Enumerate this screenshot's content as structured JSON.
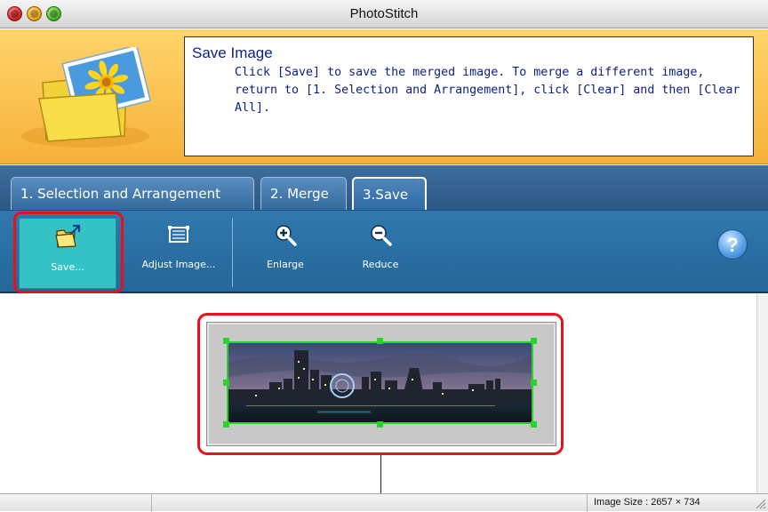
{
  "window": {
    "title": "PhotoStitch"
  },
  "header": {
    "heading": "Save Image",
    "description": "Click [Save] to save the merged image. To merge a different image, return to [1. Selection and Arrangement], click [Clear] and then [Clear All]."
  },
  "tabs": [
    {
      "label": "1. Selection and Arrangement",
      "active": false
    },
    {
      "label": "2. Merge",
      "active": false
    },
    {
      "label": "3.Save",
      "active": true
    }
  ],
  "toolbar": {
    "save_label": "Save...",
    "adjust_label": "Adjust Image...",
    "enlarge_label": "Enlarge",
    "reduce_label": "Reduce",
    "help_label": "?"
  },
  "status": {
    "image_size": "Image Size : 2657 × 734"
  },
  "icons": {
    "save": "folder-arrow-icon",
    "adjust": "frame-icon",
    "enlarge": "zoom-in-icon",
    "reduce": "zoom-out-icon",
    "help": "help-icon"
  },
  "colors": {
    "header_bg": "#f6b13a",
    "toolbar_bg": "#2f78ad",
    "save_button_bg": "#34c2c6",
    "highlight": "#e8101c",
    "selection": "#2bd22b",
    "text_blue": "#0a1f8c"
  }
}
